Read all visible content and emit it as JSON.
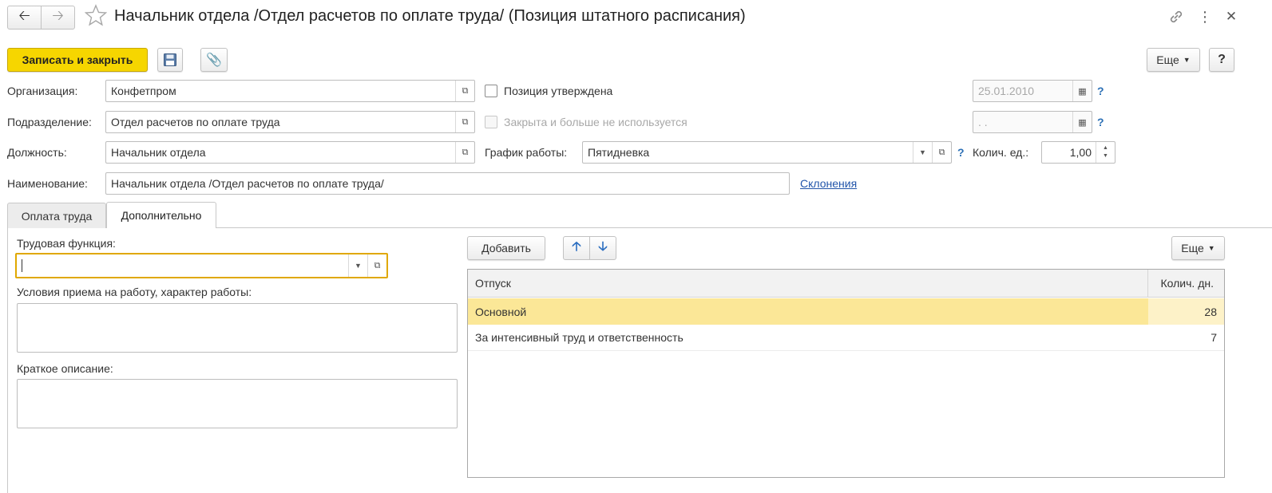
{
  "window": {
    "title": "Начальник отдела /Отдел расчетов по оплате труда/ (Позиция штатного расписания)"
  },
  "toolbar": {
    "save_close_label": "Записать и закрыть",
    "more_label": "Еще",
    "help_label": "?"
  },
  "fields": {
    "organization_label": "Организация:",
    "organization_value": "Конфетпром",
    "division_label": "Подразделение:",
    "division_value": "Отдел расчетов по оплате труда",
    "position_label": "Должность:",
    "position_value": "Начальник отдела",
    "name_label": "Наименование:",
    "name_value": "Начальник отдела /Отдел расчетов по оплате труда/",
    "declensions_link": "Склонения",
    "approved_label": "Позиция утверждена",
    "approved_date": "25.01.2010",
    "closed_label": "Закрыта и больше не используется",
    "closed_date": " .  .",
    "schedule_label": "График работы:",
    "schedule_value": "Пятидневка",
    "units_label": "Колич. ед.:",
    "units_value": "1,00",
    "help_mark": "?"
  },
  "tabs": [
    {
      "label": "Оплата труда",
      "active": false
    },
    {
      "label": "Дополнительно",
      "active": true
    }
  ],
  "additional": {
    "labor_function_label": "Трудовая функция:",
    "labor_function_value": "",
    "conditions_label": "Условия приема на работу, характер работы:",
    "description_label": "Краткое описание:"
  },
  "vacation_table": {
    "add_label": "Добавить",
    "more_label": "Еще",
    "col_vacation": "Отпуск",
    "col_days": "Колич. дн.",
    "rows": [
      {
        "name": "Основной",
        "days": "28",
        "selected": true
      },
      {
        "name": "За интенсивный труд и ответственность",
        "days": "7",
        "selected": false
      }
    ]
  },
  "colors": {
    "accent_yellow": "#f6d600",
    "selected_row": "#fbe797",
    "selected_cell": "#fdf2c8",
    "focus_border": "#e0a800",
    "link": "#2255aa"
  }
}
